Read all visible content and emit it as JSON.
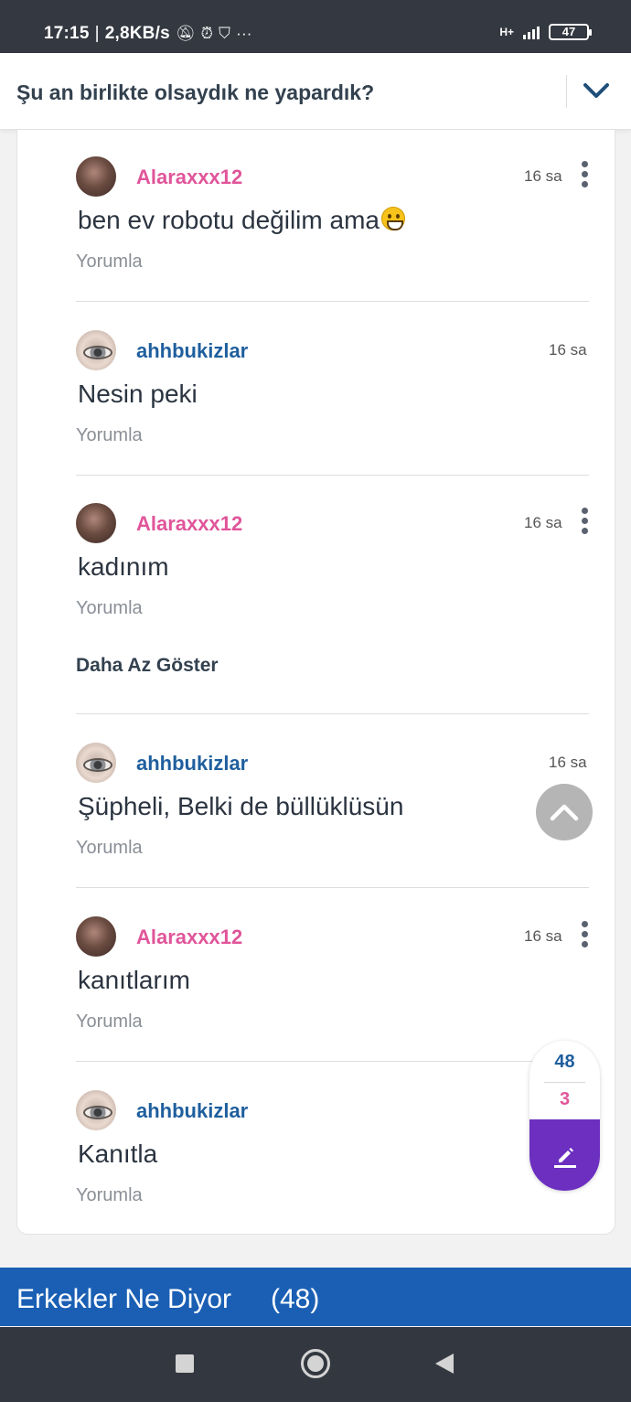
{
  "status_bar": {
    "time": "17:15",
    "speed": "2,8KB/s",
    "network": "H+",
    "battery": "47"
  },
  "header": {
    "title": "Şu an birlikte olsaydık ne yapardık?"
  },
  "comments": [
    {
      "username": "Alaraxxx12",
      "time": "16 sa",
      "text": "ben ev robotu değilim ama",
      "emoji": "grinning-face",
      "reply": "Yorumla"
    },
    {
      "username": "ahhbukizlar",
      "time": "16 sa",
      "text": "Nesin peki",
      "reply": "Yorumla"
    },
    {
      "username": "Alaraxxx12",
      "time": "16 sa",
      "text": "kadınım",
      "reply": "Yorumla"
    },
    {
      "username": "ahhbukizlar",
      "time": "16 sa",
      "text": "Şüpheli, Belki de büllüklüsün",
      "reply": "Yorumla"
    },
    {
      "username": "Alaraxxx12",
      "time": "16 sa",
      "text": "kanıtlarım",
      "reply": "Yorumla"
    },
    {
      "username": "ahhbukizlar",
      "time": "",
      "text": "Kanıtla",
      "reply": "Yorumla"
    }
  ],
  "show_less": "Daha Az Göster",
  "counters": {
    "male": "48",
    "female": "3"
  },
  "bottom_bar": {
    "title": "Erkekler Ne Diyor",
    "count": "(48)"
  },
  "colors": {
    "female_user": "#e0559a",
    "male_user": "#1f5f9e",
    "bottom_bar": "#1a5fb4",
    "write_button": "#6c2fc0"
  }
}
